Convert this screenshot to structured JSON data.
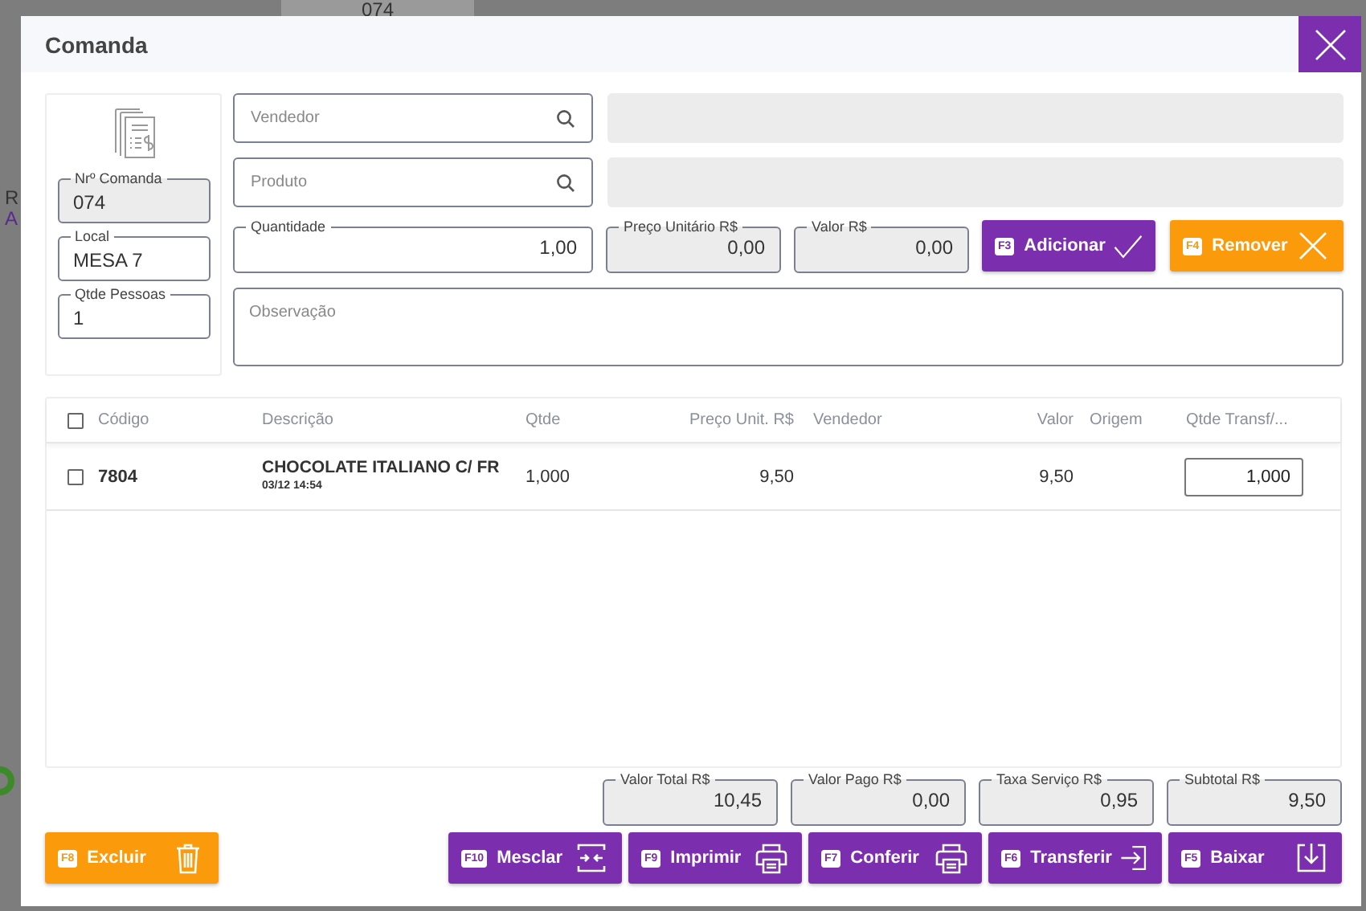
{
  "background": {
    "texts": [
      "074",
      "R",
      "A"
    ]
  },
  "dialog": {
    "title": "Comanda"
  },
  "comanda_fields": [
    {
      "label": "Nrº Comanda",
      "value": "074",
      "disabled": true
    },
    {
      "label": "Local",
      "value": "MESA 7",
      "disabled": false
    },
    {
      "label": "Qtde Pessoas",
      "value": "1",
      "disabled": false
    }
  ],
  "search_fields": [
    {
      "placeholder": "Vendedor"
    },
    {
      "placeholder": "Produto"
    }
  ],
  "amount_fields": [
    {
      "label": "Quantidade",
      "value": "1,00",
      "disabled": false
    },
    {
      "label": "Preço Unitário R$",
      "value": "0,00",
      "disabled": true
    },
    {
      "label": "Valor R$",
      "value": "0,00",
      "disabled": true
    }
  ],
  "item_buttons": [
    {
      "key": "F3",
      "label": "Adicionar",
      "kind": "add"
    },
    {
      "key": "F4",
      "label": "Remover",
      "kind": "remove"
    }
  ],
  "observation": {
    "placeholder": "Observação"
  },
  "table": {
    "all_checked": false,
    "columns": [
      "Código",
      "Descrição",
      "Qtde",
      "Preço Unit. R$",
      "Vendedor",
      "Valor",
      "Origem",
      "Qtde Transf/..."
    ],
    "rows": [
      {
        "checked": false,
        "code": "7804",
        "description": "CHOCOLATE ITALIANO C/ FR",
        "date": "03/12 14:54",
        "qty": "1,000",
        "unit_price": "9,50",
        "value": "9,50",
        "transfer_qty": "1,000"
      }
    ]
  },
  "totals": [
    {
      "label": "Valor Total R$",
      "value": "10,45"
    },
    {
      "label": "Valor Pago R$",
      "value": "0,00"
    },
    {
      "label": "Taxa Serviço R$",
      "value": "0,95"
    },
    {
      "label": "Subtotal R$",
      "value": "9,50"
    }
  ],
  "actions": [
    {
      "key": "F8",
      "label": "Excluir",
      "kind": "delete"
    },
    {
      "key": "F10",
      "label": "Mesclar",
      "kind": "merge"
    },
    {
      "key": "F9",
      "label": "Imprimir",
      "kind": "print"
    },
    {
      "key": "F7",
      "label": "Conferir",
      "kind": "print"
    },
    {
      "key": "F6",
      "label": "Transferir",
      "kind": "transfer"
    },
    {
      "key": "F5",
      "label": "Baixar",
      "kind": "settle"
    }
  ]
}
